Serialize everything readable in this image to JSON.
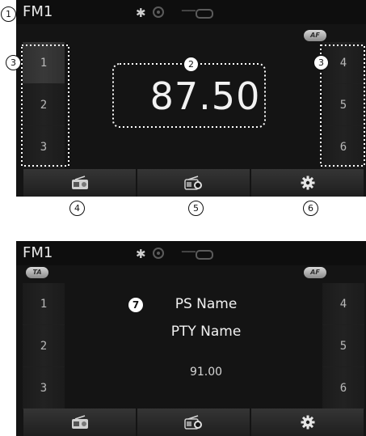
{
  "screen1": {
    "mode": "FM1",
    "af_badge": "AF",
    "frequency": "87.50",
    "presets_left": [
      "1",
      "2",
      "3"
    ],
    "presets_right": [
      "4",
      "5",
      "6"
    ]
  },
  "screen2": {
    "mode": "FM1",
    "ta_badge": "TA",
    "af_badge": "AF",
    "ps_name": "PS Name",
    "pty_name": "PTY Name",
    "frequency": "91.00",
    "presets_left": [
      "1",
      "2",
      "3"
    ],
    "presets_right": [
      "4",
      "5",
      "6"
    ]
  },
  "callouts": [
    "1",
    "2",
    "3",
    "3",
    "4",
    "5",
    "6",
    "7"
  ],
  "icons": {
    "bluetooth": "bluetooth-icon",
    "record": "record-icon",
    "usb": "usb-icon",
    "aux": "aux-icon",
    "radio": "radio-icon",
    "radio_search": "radio-search-icon",
    "settings": "gear-icon"
  },
  "colors": {
    "screen_bg": "#141414",
    "text": "#f2f2f2",
    "dotted_outline": "#ffffff"
  }
}
